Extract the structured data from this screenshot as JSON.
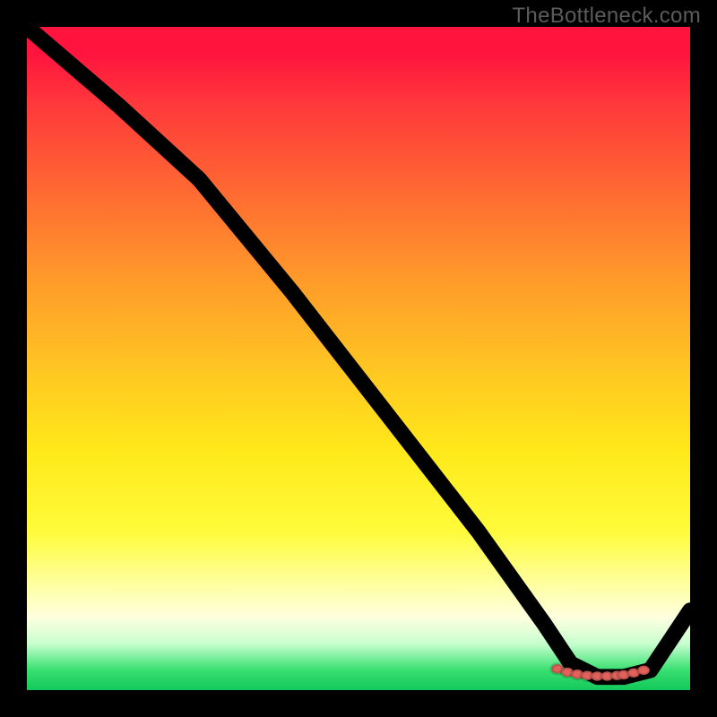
{
  "watermark": "TheBottleneck.com",
  "chart_data": {
    "type": "line",
    "title": "",
    "xlabel": "",
    "ylabel": "",
    "xlim": [
      0,
      100
    ],
    "ylim": [
      0,
      100
    ],
    "grid": false,
    "legend": false,
    "background": "gradient-red-yellow-green",
    "series": [
      {
        "name": "curve",
        "x": [
          0,
          14,
          26,
          40,
          54,
          68,
          78,
          82,
          86,
          90,
          94,
          100
        ],
        "values": [
          100,
          88,
          77,
          60,
          42,
          24,
          10,
          4,
          2,
          2,
          3,
          12
        ]
      }
    ],
    "scatter_points": {
      "name": "highlight-dots",
      "color": "#e1625b",
      "x": [
        80,
        81.5,
        83,
        84.5,
        86,
        87.5,
        89,
        90,
        91.5,
        93
      ],
      "y": [
        3.2,
        2.7,
        2.4,
        2.2,
        2.1,
        2.1,
        2.2,
        2.3,
        2.6,
        3.0
      ]
    }
  }
}
